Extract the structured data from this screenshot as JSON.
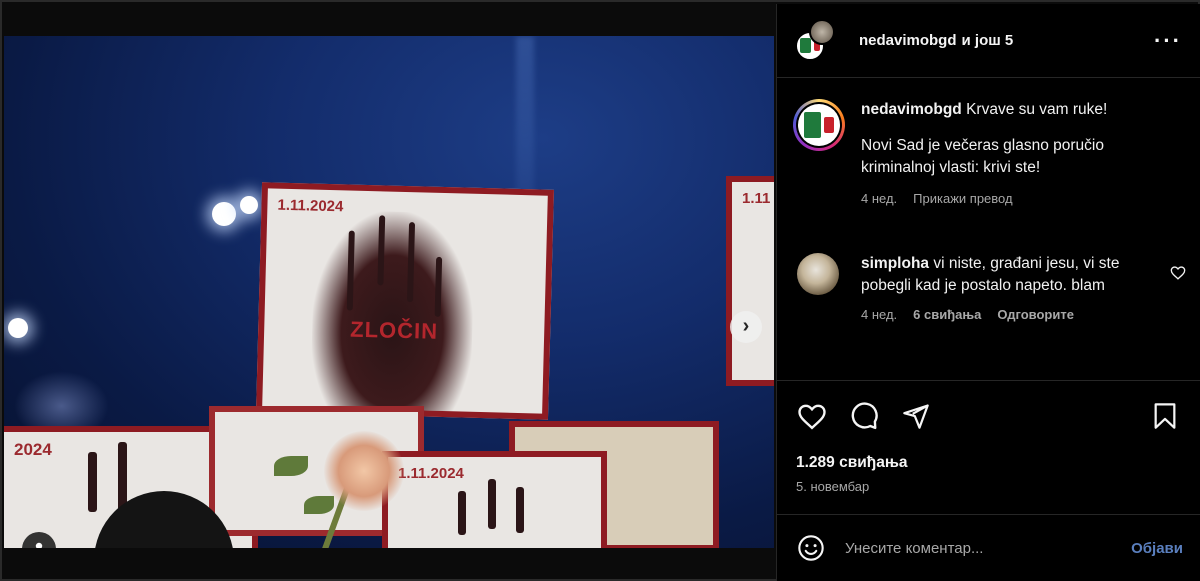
{
  "post": {
    "header": {
      "account": "nedavimobgd",
      "coauthors_text": "и још 5",
      "more_icon": "more-horizontal-icon"
    },
    "photo": {
      "sign_date_1": "1.11.2024",
      "sign_date_2": "1.11",
      "sign_date_3": "2024",
      "sign_date_4": "1.11.2024",
      "sign_word": "ZLOČIN",
      "carousel_count": 7,
      "carousel_active": 0
    },
    "caption": {
      "username": "nedavimobgd",
      "line1": "Krvave su vam ruke!",
      "line2": "Novi Sad je večeras glasno poručio kriminalnoj vlasti: krivi ste!",
      "time": "4 нед.",
      "translate": "Прикажи превод"
    },
    "comment": {
      "username": "simploha",
      "text": "vi niste, građani jesu, vi ste pobegli kad je postalo napeto. blam",
      "time": "4 нед.",
      "likes": "6 свиђања",
      "reply": "Одговорите"
    },
    "likes_text": "1.289 свиђања",
    "date_text": "5. новембар",
    "composer": {
      "placeholder": "Унесите коментар...",
      "post_label": "Објави"
    },
    "colors": {
      "link_blue": "#5a7fbe",
      "muted": "#a8a8a8",
      "background": "#000000",
      "active_dot": "#3897f0"
    }
  }
}
